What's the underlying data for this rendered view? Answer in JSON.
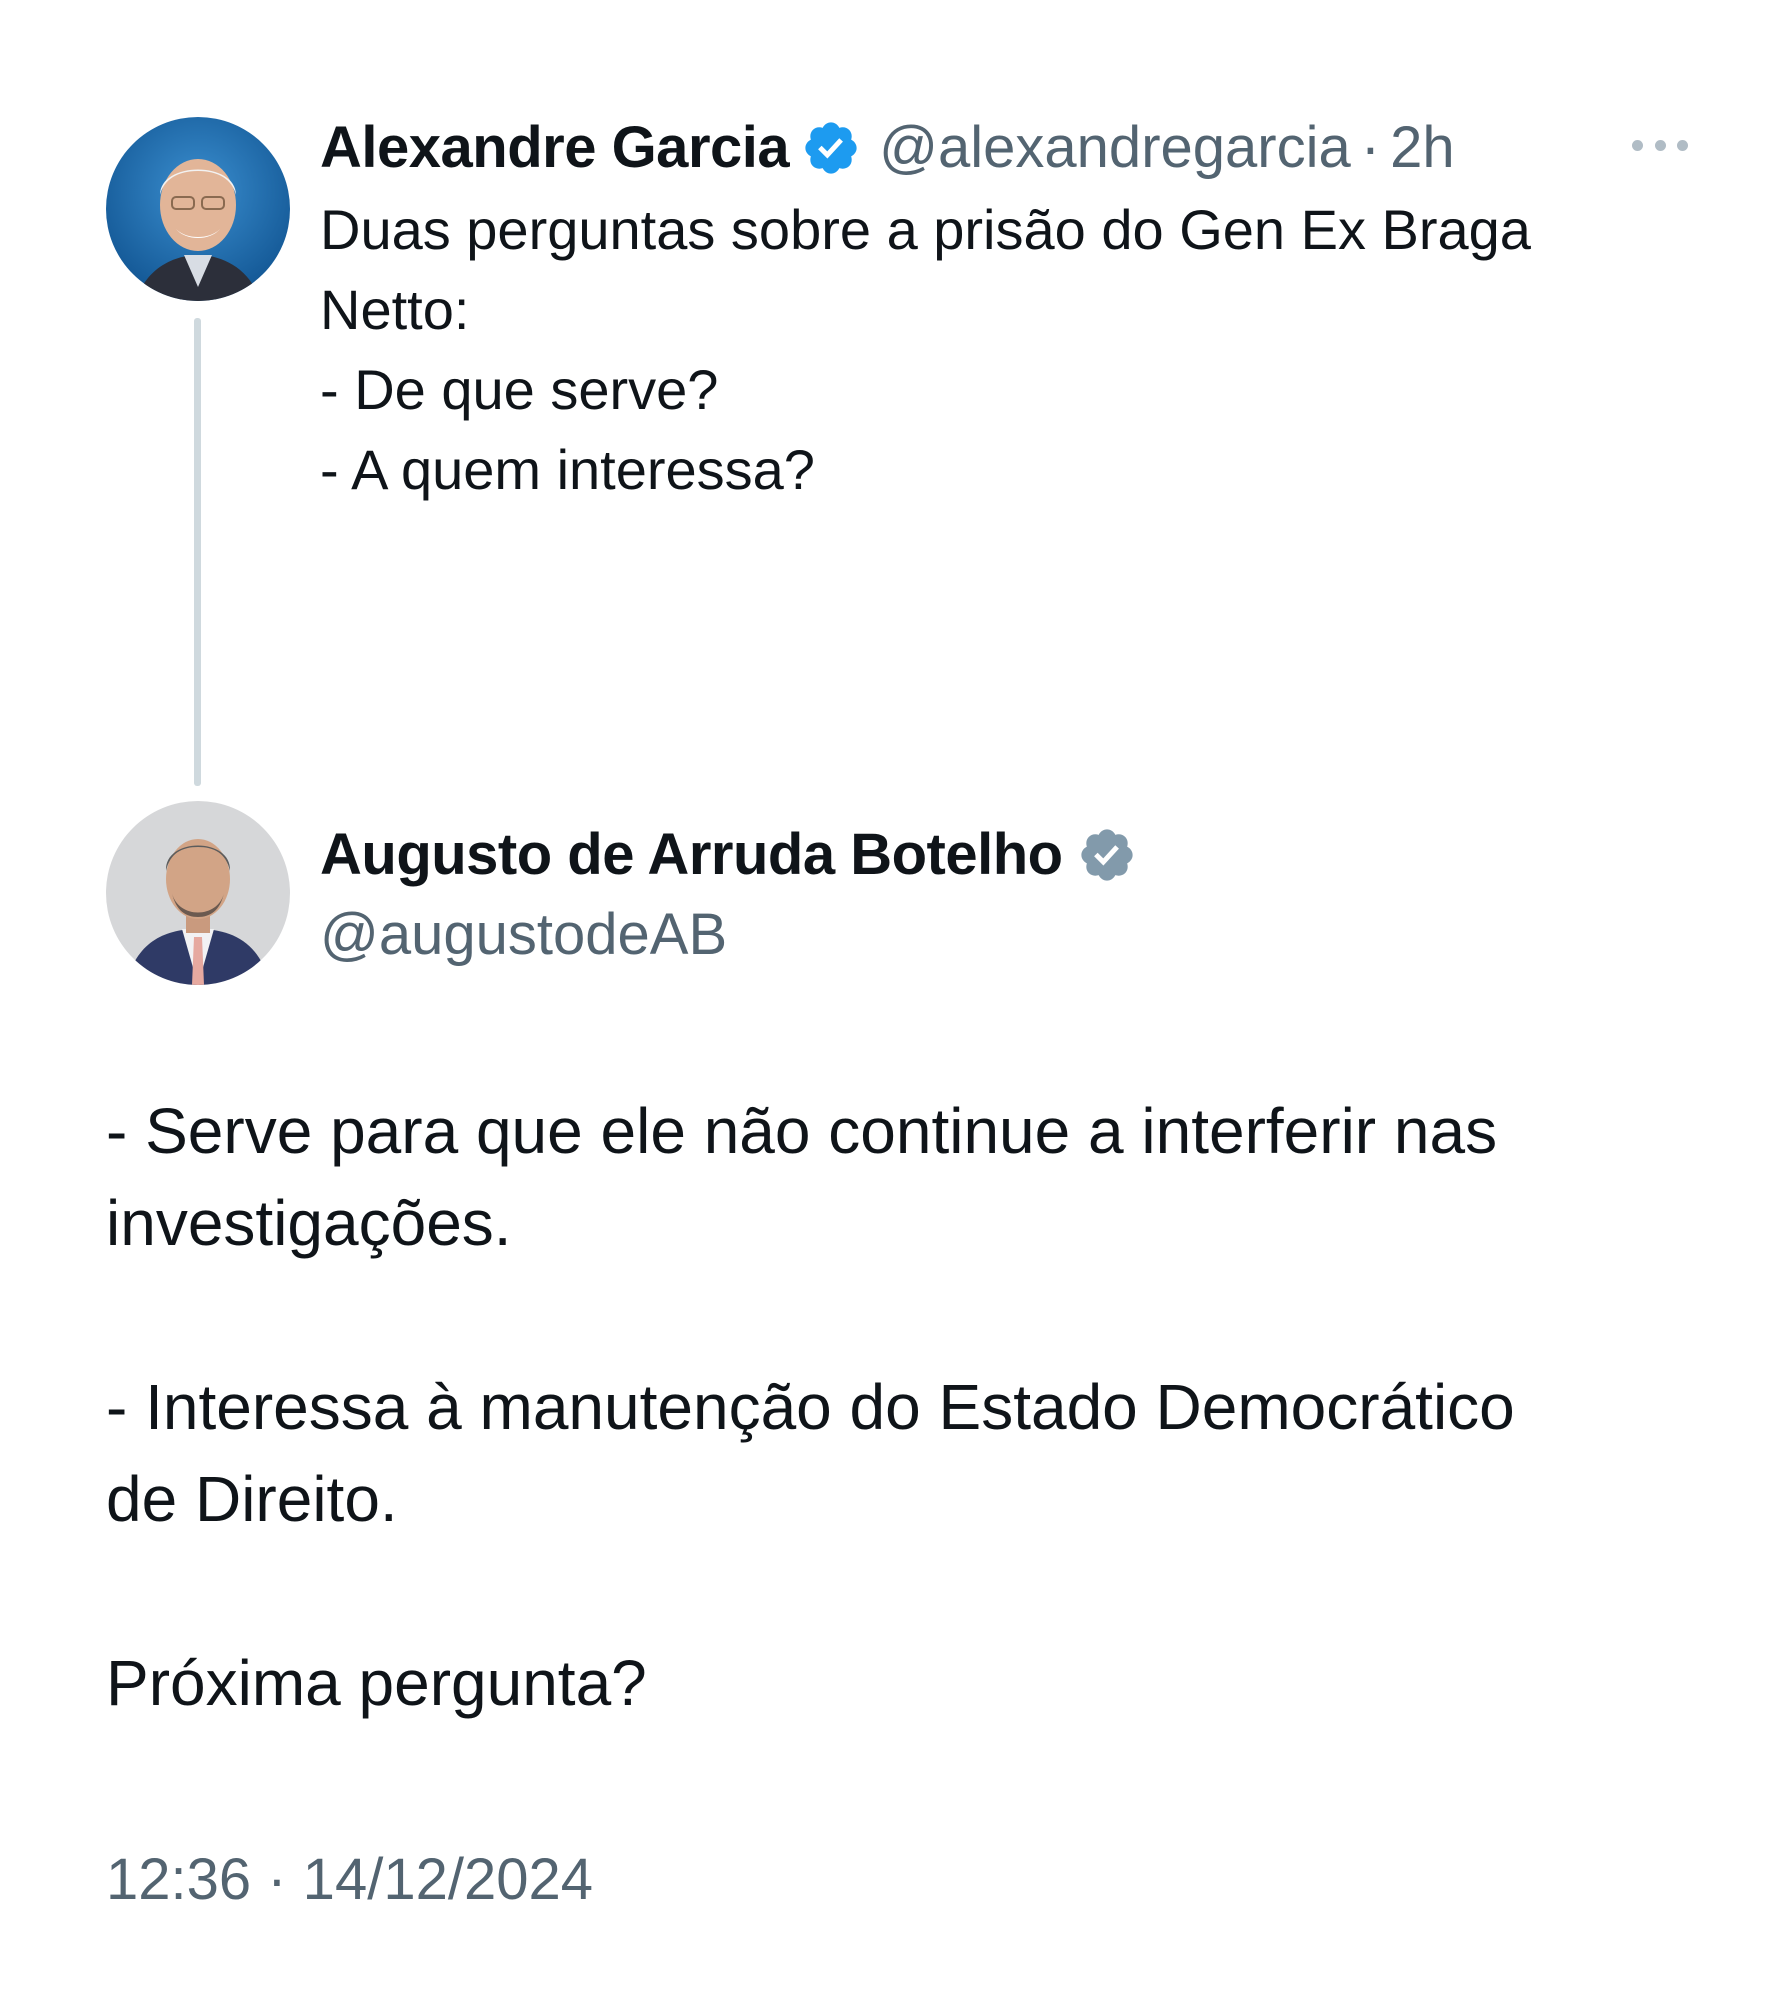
{
  "tweet_1": {
    "name": "Alexandre Garcia",
    "handle": "@alexandregarcia",
    "separator": "·",
    "time": "2h",
    "text": "Duas perguntas sobre a prisão do Gen Ex Braga\nNetto:\n- De que serve?\n- A quem interessa?",
    "verified_color": "#1d9bf0",
    "more_icon": "more-horizontal-icon"
  },
  "tweet_2": {
    "name": "Augusto de Arruda Botelho",
    "handle": "@augustodeAB",
    "verified_color": "#829aab",
    "text": "- Serve para que ele não continue a interferir nas\ninvestigações.\n\n- Interessa à manutenção do Estado Democrático\nde Direito.\n\nPróxima pergunta?",
    "timestamp": "12:36 · 14/12/2024"
  },
  "colors": {
    "text_primary": "#0f1419",
    "text_secondary": "#536471",
    "thread_line": "#cfd9de"
  }
}
